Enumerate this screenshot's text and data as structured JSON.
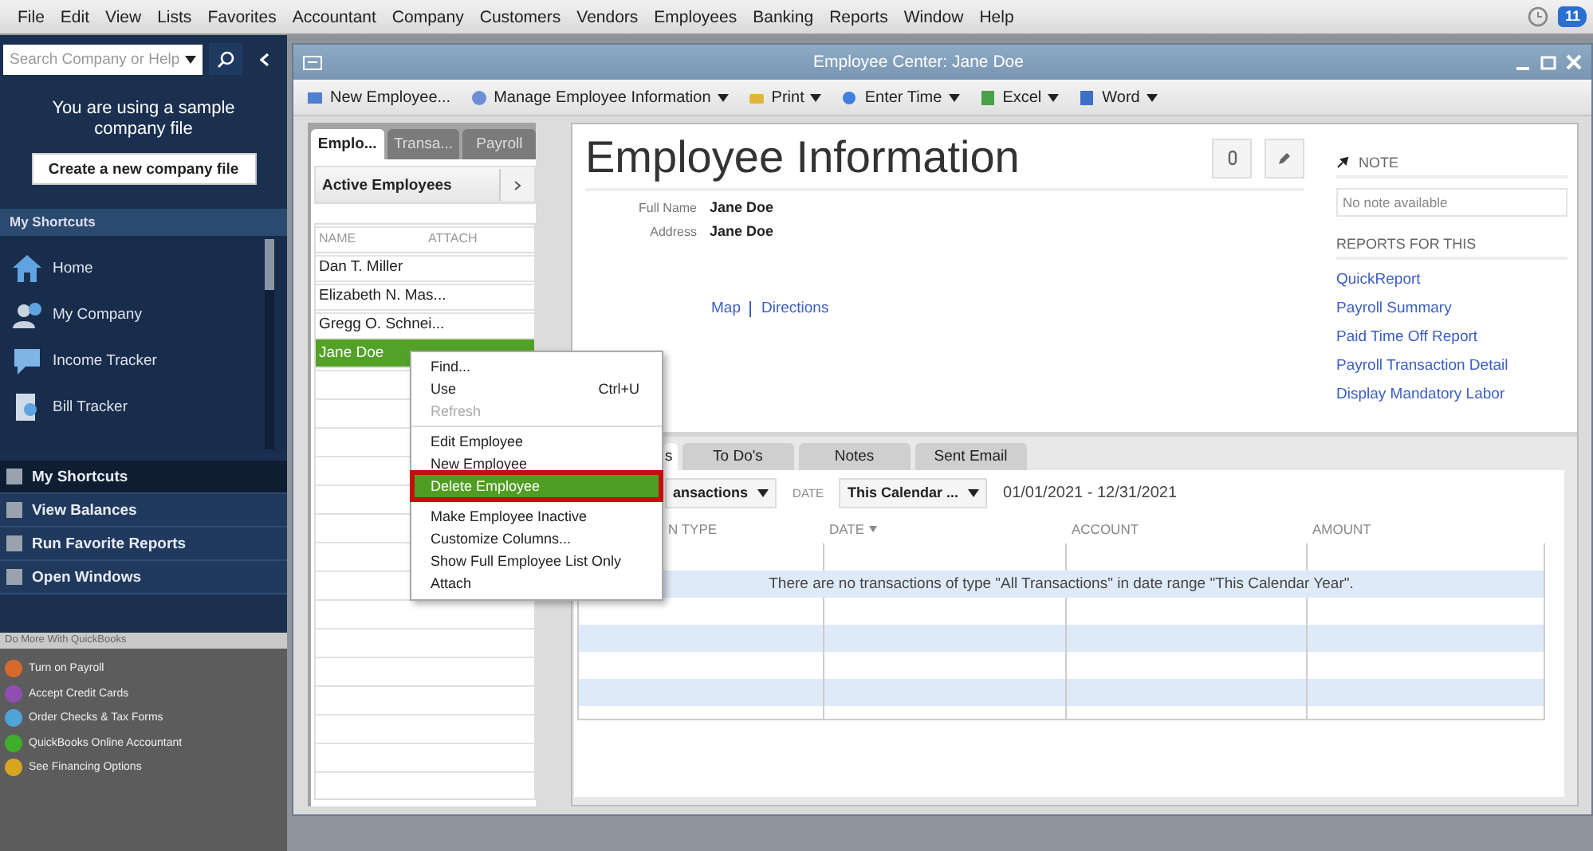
{
  "menu_bar": {
    "items": [
      "File",
      "Edit",
      "View",
      "Lists",
      "Favorites",
      "Accountant",
      "Company",
      "Customers",
      "Vendors",
      "Employees",
      "Banking",
      "Reports",
      "Window",
      "Help"
    ],
    "notification_badge": "11"
  },
  "sidebar": {
    "search": {
      "placeholder": "Search Company or Help"
    },
    "notice": "You are using a sample company file",
    "create_button": "Create a new company file",
    "shortcuts_header": "My Shortcuts",
    "shortcuts": [
      "Home",
      "My Company",
      "Income Tracker",
      "Bill Tracker"
    ],
    "sections": [
      {
        "label": "My Shortcuts",
        "selected": true
      },
      {
        "label": "View Balances",
        "selected": false
      },
      {
        "label": "Run Favorite Reports",
        "selected": false
      },
      {
        "label": "Open Windows",
        "selected": false
      }
    ],
    "promo_header": "Do More With QuickBooks",
    "promos": [
      {
        "label": "Turn on Payroll",
        "color": "#d8692c"
      },
      {
        "label": "Accept Credit Cards",
        "color": "#8e4fb0"
      },
      {
        "label": "Order Checks & Tax Forms",
        "color": "#4ea3d8"
      },
      {
        "label": "QuickBooks Online Accountant",
        "color": "#3fae2a"
      },
      {
        "label": "See Financing Options",
        "color": "#d9a521"
      }
    ]
  },
  "window": {
    "title": "Employee Center: Jane Doe",
    "toolbar": [
      {
        "label": "New Employee...",
        "dropdown": false
      },
      {
        "label": "Manage Employee Information",
        "dropdown": true
      },
      {
        "label": "Print",
        "dropdown": true
      },
      {
        "label": "Enter Time",
        "dropdown": true
      },
      {
        "label": "Excel",
        "dropdown": true
      },
      {
        "label": "Word",
        "dropdown": true
      }
    ],
    "list_tabs": [
      {
        "label": "Emplo...",
        "selected": true
      },
      {
        "label": "Transa...",
        "selected": false
      },
      {
        "label": "Payroll",
        "selected": false
      }
    ],
    "list_filter": "Active Employees",
    "list_columns": [
      "NAME",
      "ATTACH"
    ],
    "employees": [
      {
        "name": "Dan T. Miller",
        "selected": false
      },
      {
        "name": "Elizabeth N. Mas...",
        "selected": false
      },
      {
        "name": "Gregg O. Schnei...",
        "selected": false
      },
      {
        "name": "Jane Doe",
        "selected": true
      }
    ],
    "info": {
      "heading": "Employee Information",
      "fields": [
        {
          "label": "Full Name",
          "value": "Jane Doe"
        },
        {
          "label": "Address",
          "value": "Jane Doe"
        }
      ],
      "links": [
        "Map",
        "Directions"
      ]
    },
    "note": {
      "header": "NOTE",
      "text": "No note available"
    },
    "reports": {
      "header": "REPORTS FOR THIS",
      "links": [
        "QuickReport",
        "Payroll Summary",
        "Paid Time Off Report",
        "Payroll Transaction Detail",
        "Display Mandatory Labor"
      ]
    },
    "detail_tabs": [
      {
        "label": "s",
        "selected": true
      },
      {
        "label": "To Do's",
        "selected": false
      },
      {
        "label": "Notes",
        "selected": false
      },
      {
        "label": "Sent Email",
        "selected": false
      }
    ],
    "filters": {
      "type": "ansactions",
      "date_label": "DATE",
      "date": "This Calendar ...",
      "range": "01/01/2021 - 12/31/2021"
    },
    "columns": [
      {
        "label": "N TYPE",
        "sorted": false
      },
      {
        "label": "DATE",
        "sorted": true
      },
      {
        "label": "ACCOUNT",
        "sorted": false
      },
      {
        "label": "AMOUNT",
        "sorted": false
      }
    ],
    "empty_message": "There are no transactions of type \"All Transactions\" in date range \"This Calendar Year\"."
  },
  "context_menu": {
    "items": [
      {
        "kind": "item",
        "label": "Find...",
        "disabled": false,
        "selected": false,
        "outlined": false
      },
      {
        "kind": "item",
        "label": "Use",
        "shortcut": "Ctrl+U",
        "disabled": false,
        "selected": false,
        "outlined": false
      },
      {
        "kind": "item",
        "label": "Refresh",
        "disabled": true,
        "selected": false,
        "outlined": false
      },
      {
        "kind": "separator"
      },
      {
        "kind": "item",
        "label": "Edit Employee",
        "disabled": false,
        "selected": false,
        "outlined": false
      },
      {
        "kind": "item",
        "label": "New Employee",
        "disabled": false,
        "selected": false,
        "outlined": false
      },
      {
        "kind": "item",
        "label": "Delete Employee",
        "disabled": false,
        "selected": true,
        "outlined": true
      },
      {
        "kind": "separator"
      },
      {
        "kind": "item",
        "label": "Make Employee Inactive",
        "disabled": false,
        "selected": false,
        "outlined": false
      },
      {
        "kind": "item",
        "label": "Customize Columns...",
        "disabled": false,
        "selected": false,
        "outlined": false
      },
      {
        "kind": "item",
        "label": "Show Full Employee List Only",
        "disabled": false,
        "selected": false,
        "outlined": false
      },
      {
        "kind": "item",
        "label": "Attach",
        "disabled": false,
        "selected": false,
        "outlined": false
      }
    ]
  }
}
